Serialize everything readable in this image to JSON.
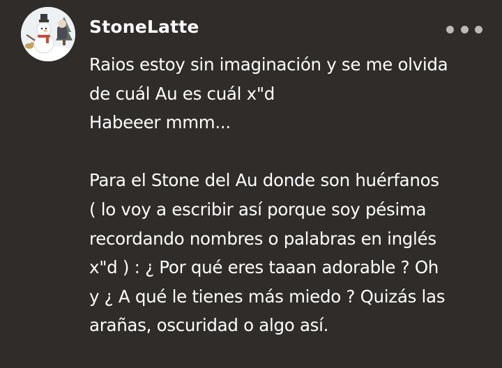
{
  "comment": {
    "username": "StoneLatte",
    "avatar_icon": "snowman-avatar-icon",
    "more_icon": "more-options-icon",
    "lines": [
      "Raios estoy sin imaginación y se me olvida",
      "de cuál Au es cuál x\"d",
      "Habeeer mmm...",
      "",
      "Para el Stone del Au donde son huérfanos",
      "( lo voy a escribir así porque soy pésima",
      "recordando nombres o palabras en inglés",
      "x\"d ) : ¿ Por qué eres taaan adorable ? Oh",
      "y ¿ A qué le tienes más miedo ? Quizás las",
      "arañas, oscuridad o algo así."
    ]
  },
  "colors": {
    "background": "#2f2c29",
    "text": "#ffffff",
    "dots": "#bdbab6"
  }
}
